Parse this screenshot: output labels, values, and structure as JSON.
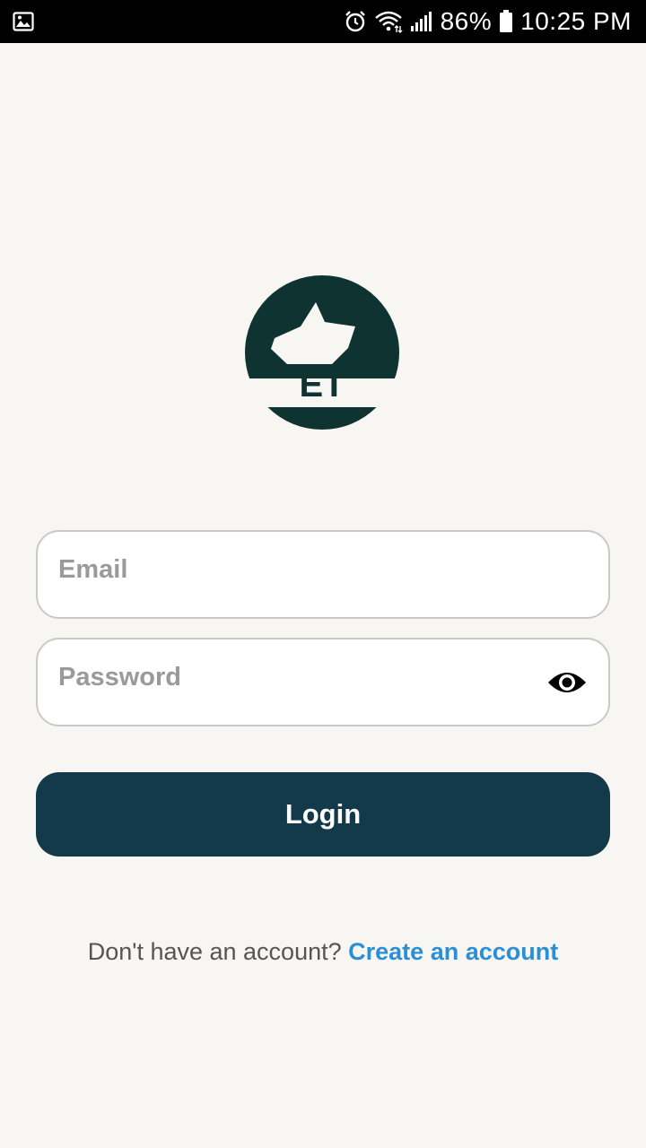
{
  "status_bar": {
    "battery": "86%",
    "time": "10:25 PM",
    "icons": [
      "image-icon",
      "alarm-icon",
      "wifi-icon",
      "signal-icon",
      "battery-icon"
    ]
  },
  "logo": {
    "text": "ET",
    "color": "#0f3331"
  },
  "form": {
    "email_placeholder": "Email",
    "password_placeholder": "Password",
    "password_toggle_icon": "eye-icon"
  },
  "login_button": {
    "label": "Login",
    "color": "#133a4a"
  },
  "signup": {
    "prompt": "Don't have an account?",
    "link_label": "Create an account",
    "link_color": "#2a8fd6"
  }
}
